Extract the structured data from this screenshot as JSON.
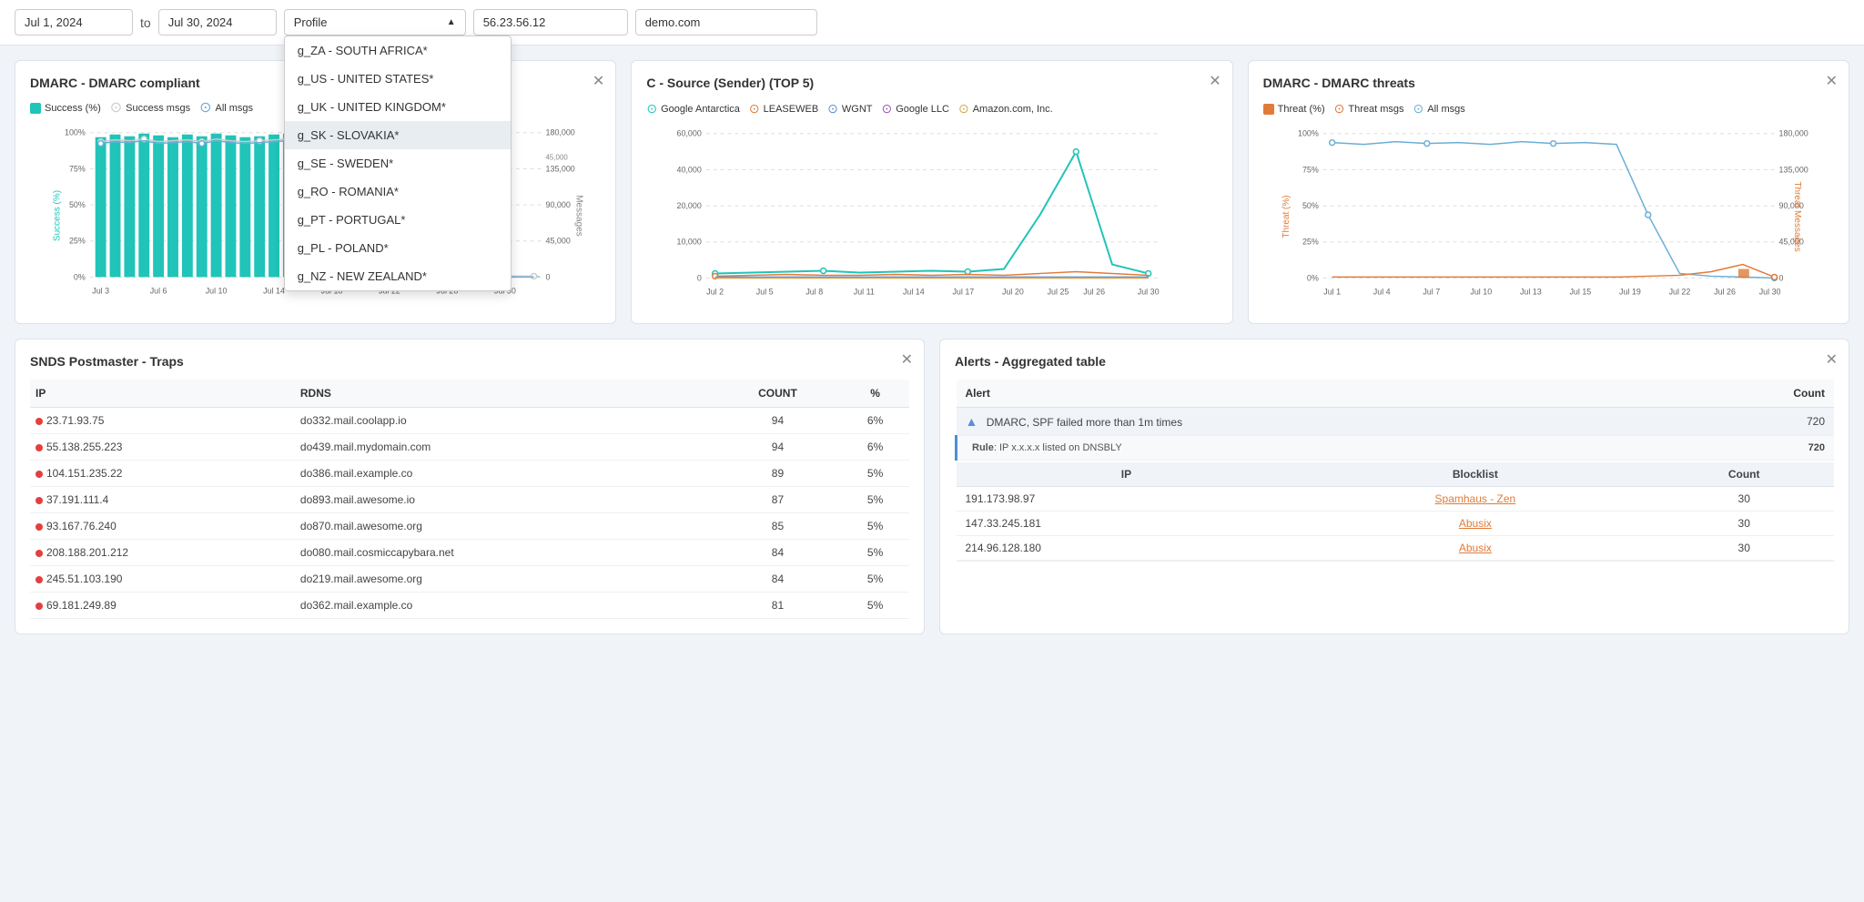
{
  "topbar": {
    "date_from": "Jul 1, 2024",
    "date_to": "Jul 30, 2024",
    "to_label": "to",
    "profile_label": "Profile",
    "ip_value": "56.23.56.12",
    "domain_value": "demo.com",
    "profile_options": [
      "g_ZA - SOUTH AFRICA*",
      "g_US - UNITED STATES*",
      "g_UK - UNITED KINGDOM*",
      "g_SK - SLOVAKIA*",
      "g_SE - SWEDEN*",
      "g_RO - ROMANIA*",
      "g_PT - PORTUGAL*",
      "g_PL - POLAND*",
      "g_NZ - NEW ZEALAND*"
    ],
    "highlighted_profile": "g_SK - SLOVAKIA*"
  },
  "card1": {
    "title": "DMARC - DMARC compliant",
    "legend": {
      "success_pct_label": "Success (%)",
      "success_msgs_label": "Success msgs",
      "all_msgs_label": "All msgs"
    },
    "y_left": "Success (%)",
    "y_right": "Messages",
    "x_labels": [
      "Jul 3",
      "Jul 6",
      "Jul 10",
      "Jul 14",
      "Jul 18",
      "Jul 22",
      "Jul 26",
      "Jul 30"
    ],
    "close_symbol": "✕"
  },
  "card2": {
    "title": "C - Source (Sender) (TOP 5)",
    "legend": {
      "items": [
        "Google Antarctica",
        "LEASEWEB",
        "WGNT",
        "Google LLC",
        "Amazon.com, Inc."
      ]
    },
    "x_labels": [
      "Jul 2",
      "Jul 5",
      "Jul 8",
      "Jul 11",
      "Jul 14",
      "Jul 17",
      "Jul 20",
      "Jul 25",
      "Jul 26",
      "Jul 30"
    ],
    "close_symbol": "✕"
  },
  "card3": {
    "title": "DMARC - DMARC threats",
    "legend": {
      "threat_pct_label": "Threat (%)",
      "threat_msgs_label": "Threat msgs",
      "all_msgs_label": "All msgs"
    },
    "y_left": "Threat (%)",
    "y_right": "Threat Messages",
    "x_labels": [
      "Jul 1",
      "Jul 4",
      "Jul 7",
      "Jul 10",
      "Jul 13",
      "Jul 15",
      "Jul 19",
      "Jul 22",
      "Jul 26",
      "Jul 30"
    ],
    "close_symbol": "✕"
  },
  "snds_card": {
    "title": "SNDS Postmaster - Traps",
    "close_symbol": "✕",
    "columns": [
      "IP",
      "RDNS",
      "COUNT",
      "%"
    ],
    "rows": [
      {
        "ip": "23.71.93.75",
        "rdns": "do332.mail.coolapp.io",
        "count": "94",
        "pct": "6%"
      },
      {
        "ip": "55.138.255.223",
        "rdns": "do439.mail.mydomain.com",
        "count": "94",
        "pct": "6%"
      },
      {
        "ip": "104.151.235.22",
        "rdns": "do386.mail.example.co",
        "count": "89",
        "pct": "5%"
      },
      {
        "ip": "37.191.111.4",
        "rdns": "do893.mail.awesome.io",
        "count": "87",
        "pct": "5%"
      },
      {
        "ip": "93.167.76.240",
        "rdns": "do870.mail.awesome.org",
        "count": "85",
        "pct": "5%"
      },
      {
        "ip": "208.188.201.212",
        "rdns": "do080.mail.cosmiccapybara.net",
        "count": "84",
        "pct": "5%"
      },
      {
        "ip": "245.51.103.190",
        "rdns": "do219.mail.awesome.org",
        "count": "84",
        "pct": "5%"
      },
      {
        "ip": "69.181.249.89",
        "rdns": "do362.mail.example.co",
        "count": "81",
        "pct": "5%"
      }
    ]
  },
  "alerts_card": {
    "title": "Alerts - Aggregated table",
    "close_symbol": "✕",
    "columns": [
      "Alert",
      "Count"
    ],
    "main_alert": {
      "label": "DMARC, SPF failed more than 1m times",
      "count": "720"
    },
    "rule_text": "Rule: IP x.x.x.x listed on DNSBLY",
    "rule_count": "720",
    "sub_columns": [
      "IP",
      "Blocklist"
    ],
    "sub_rows": [
      {
        "ip": "191.173.98.97",
        "blocklist": "Spamhaus - Zen",
        "count": "30"
      },
      {
        "ip": "147.33.245.181",
        "blocklist": "Abusix",
        "count": "30"
      },
      {
        "ip": "214.96.128.180",
        "blocklist": "Abusix",
        "count": "30"
      }
    ]
  },
  "colors": {
    "teal": "#20c4b8",
    "white_dot": "#e0e0e0",
    "blue_line": "#6baed6",
    "orange": "#e07b39",
    "red": "#e53e3e",
    "green": "#22c4b5",
    "leaseweb": "#e07b39",
    "wgnt": "#5b8dd9",
    "google_llc": "#9b59b6",
    "amazon": "#d4a94b",
    "google_ant": "#20c4b8"
  }
}
